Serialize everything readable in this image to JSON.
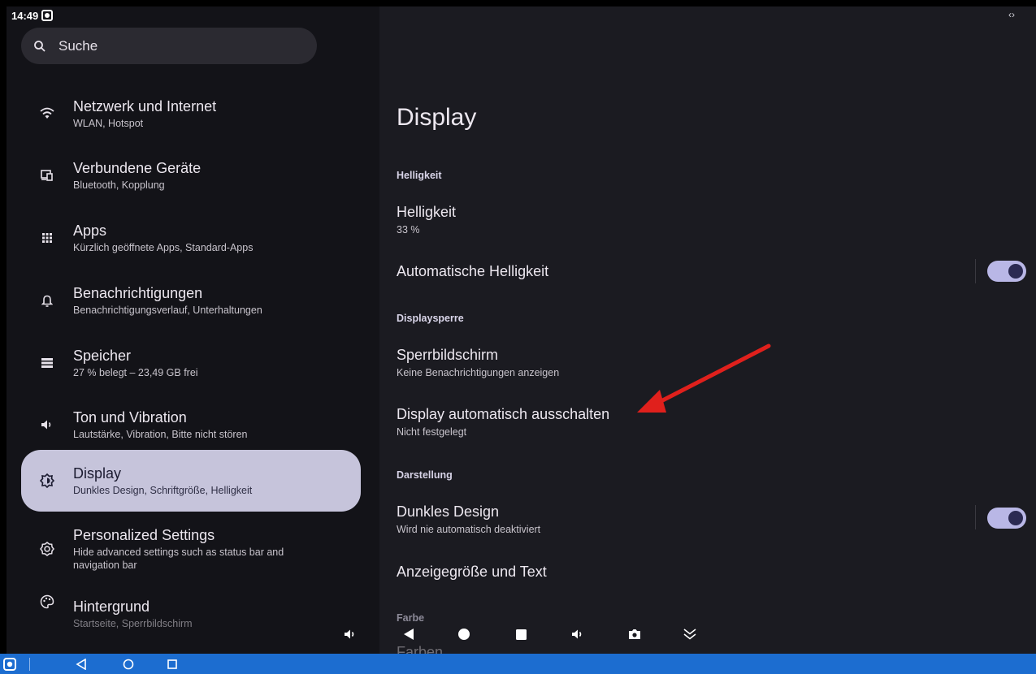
{
  "status_bar": {
    "time": "14:49"
  },
  "search": {
    "placeholder": "Suche"
  },
  "sidebar": {
    "items": [
      {
        "title": "Netzwerk und Internet",
        "subtitle": "WLAN, Hotspot",
        "icon": "wifi-icon"
      },
      {
        "title": "Verbundene Geräte",
        "subtitle": "Bluetooth, Kopplung",
        "icon": "connected-devices-icon"
      },
      {
        "title": "Apps",
        "subtitle": "Kürzlich geöffnete Apps, Standard-Apps",
        "icon": "apps-grid-icon"
      },
      {
        "title": "Benachrichtigungen",
        "subtitle": "Benachrichtigungsverlauf, Unterhaltungen",
        "icon": "bell-icon"
      },
      {
        "title": "Speicher",
        "subtitle": "27 % belegt – 23,49 GB frei",
        "icon": "storage-icon"
      },
      {
        "title": "Ton und Vibration",
        "subtitle": "Lautstärke, Vibration, Bitte nicht stören",
        "icon": "volume-icon"
      },
      {
        "title": "Display",
        "subtitle": "Dunkles Design, Schriftgröße, Helligkeit",
        "icon": "display-brightness-icon",
        "active": true
      },
      {
        "title": "Personalized Settings",
        "subtitle": "Hide advanced settings such as status bar and navigation bar",
        "icon": "settings-gear-icon"
      },
      {
        "title": "Hintergrund",
        "subtitle": "Startseite, Sperrbildschirm",
        "icon": "palette-icon"
      }
    ]
  },
  "main": {
    "title": "Display",
    "sections": {
      "brightness_header": "Helligkeit",
      "lock_header": "Displaysperre",
      "appearance_header": "Darstellung",
      "color_header": "Farbe"
    },
    "prefs": {
      "brightness": {
        "title": "Helligkeit",
        "value": "33 %"
      },
      "auto_brightness": {
        "title": "Automatische Helligkeit",
        "enabled": true
      },
      "lock_screen": {
        "title": "Sperrbildschirm",
        "subtitle": "Keine Benachrichtigungen anzeigen"
      },
      "screen_timeout": {
        "title": "Display automatisch ausschalten",
        "subtitle": "Nicht festgelegt"
      },
      "dark_theme": {
        "title": "Dunkles Design",
        "subtitle": "Wird nie automatisch deaktiviert",
        "enabled": true
      },
      "display_size": {
        "title": "Anzeigegröße und Text"
      },
      "colors": {
        "title": "Farben"
      }
    }
  },
  "colors": {
    "accent": "#b9b7e6",
    "active_item_bg": "#c6c4db",
    "annotation_arrow": "#e0201c",
    "taskbar": "#1c6dd0"
  }
}
